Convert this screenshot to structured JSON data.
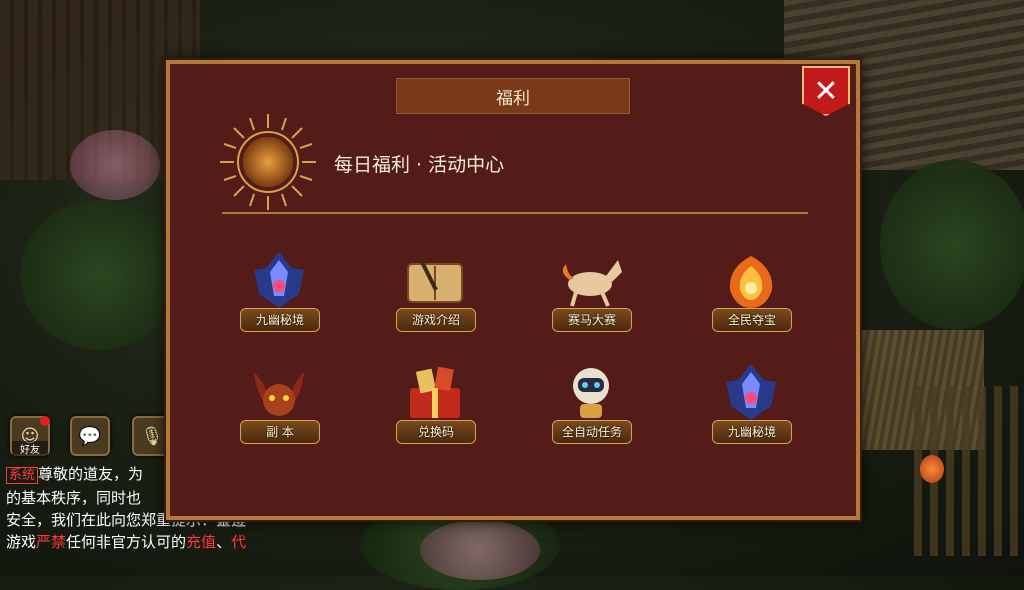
{
  "modal": {
    "title": "福利",
    "headline": "每日福利 · 活动中心",
    "close_symbol": "✕",
    "items": [
      {
        "label": "九幽秘境",
        "icon": "crystal-portal-icon"
      },
      {
        "label": "游戏介绍",
        "icon": "scroll-book-icon"
      },
      {
        "label": "赛马大赛",
        "icon": "horse-icon"
      },
      {
        "label": "全民夺宝",
        "icon": "phoenix-flame-icon"
      },
      {
        "label": "副 本",
        "icon": "demon-helm-icon"
      },
      {
        "label": "兑换码",
        "icon": "gift-box-icon"
      },
      {
        "label": "全自动任务",
        "icon": "robot-icon"
      },
      {
        "label": "九幽秘境",
        "icon": "crystal-portal-icon"
      }
    ]
  },
  "hud": {
    "friends_label": "好友",
    "chat_icon": "chat-bubble-icon",
    "mic_icon": "microphone-icon"
  },
  "chat": {
    "system_tag": "系统",
    "line1": "尊敬的道友，为",
    "line2": "的基本秩序，同时也",
    "line3": "安全，我们在此向您郑重提示：靈遵",
    "line4_a": "游戏",
    "line4_b": "严禁",
    "line4_c": "任何非官方认可的",
    "line4_d": "充值",
    "line4_e": "、",
    "line4_f": "代"
  },
  "colors": {
    "panel": "#531c18",
    "border": "#b17a3b",
    "title_bar": "#7a3a1a",
    "close": "#c21a1a"
  }
}
